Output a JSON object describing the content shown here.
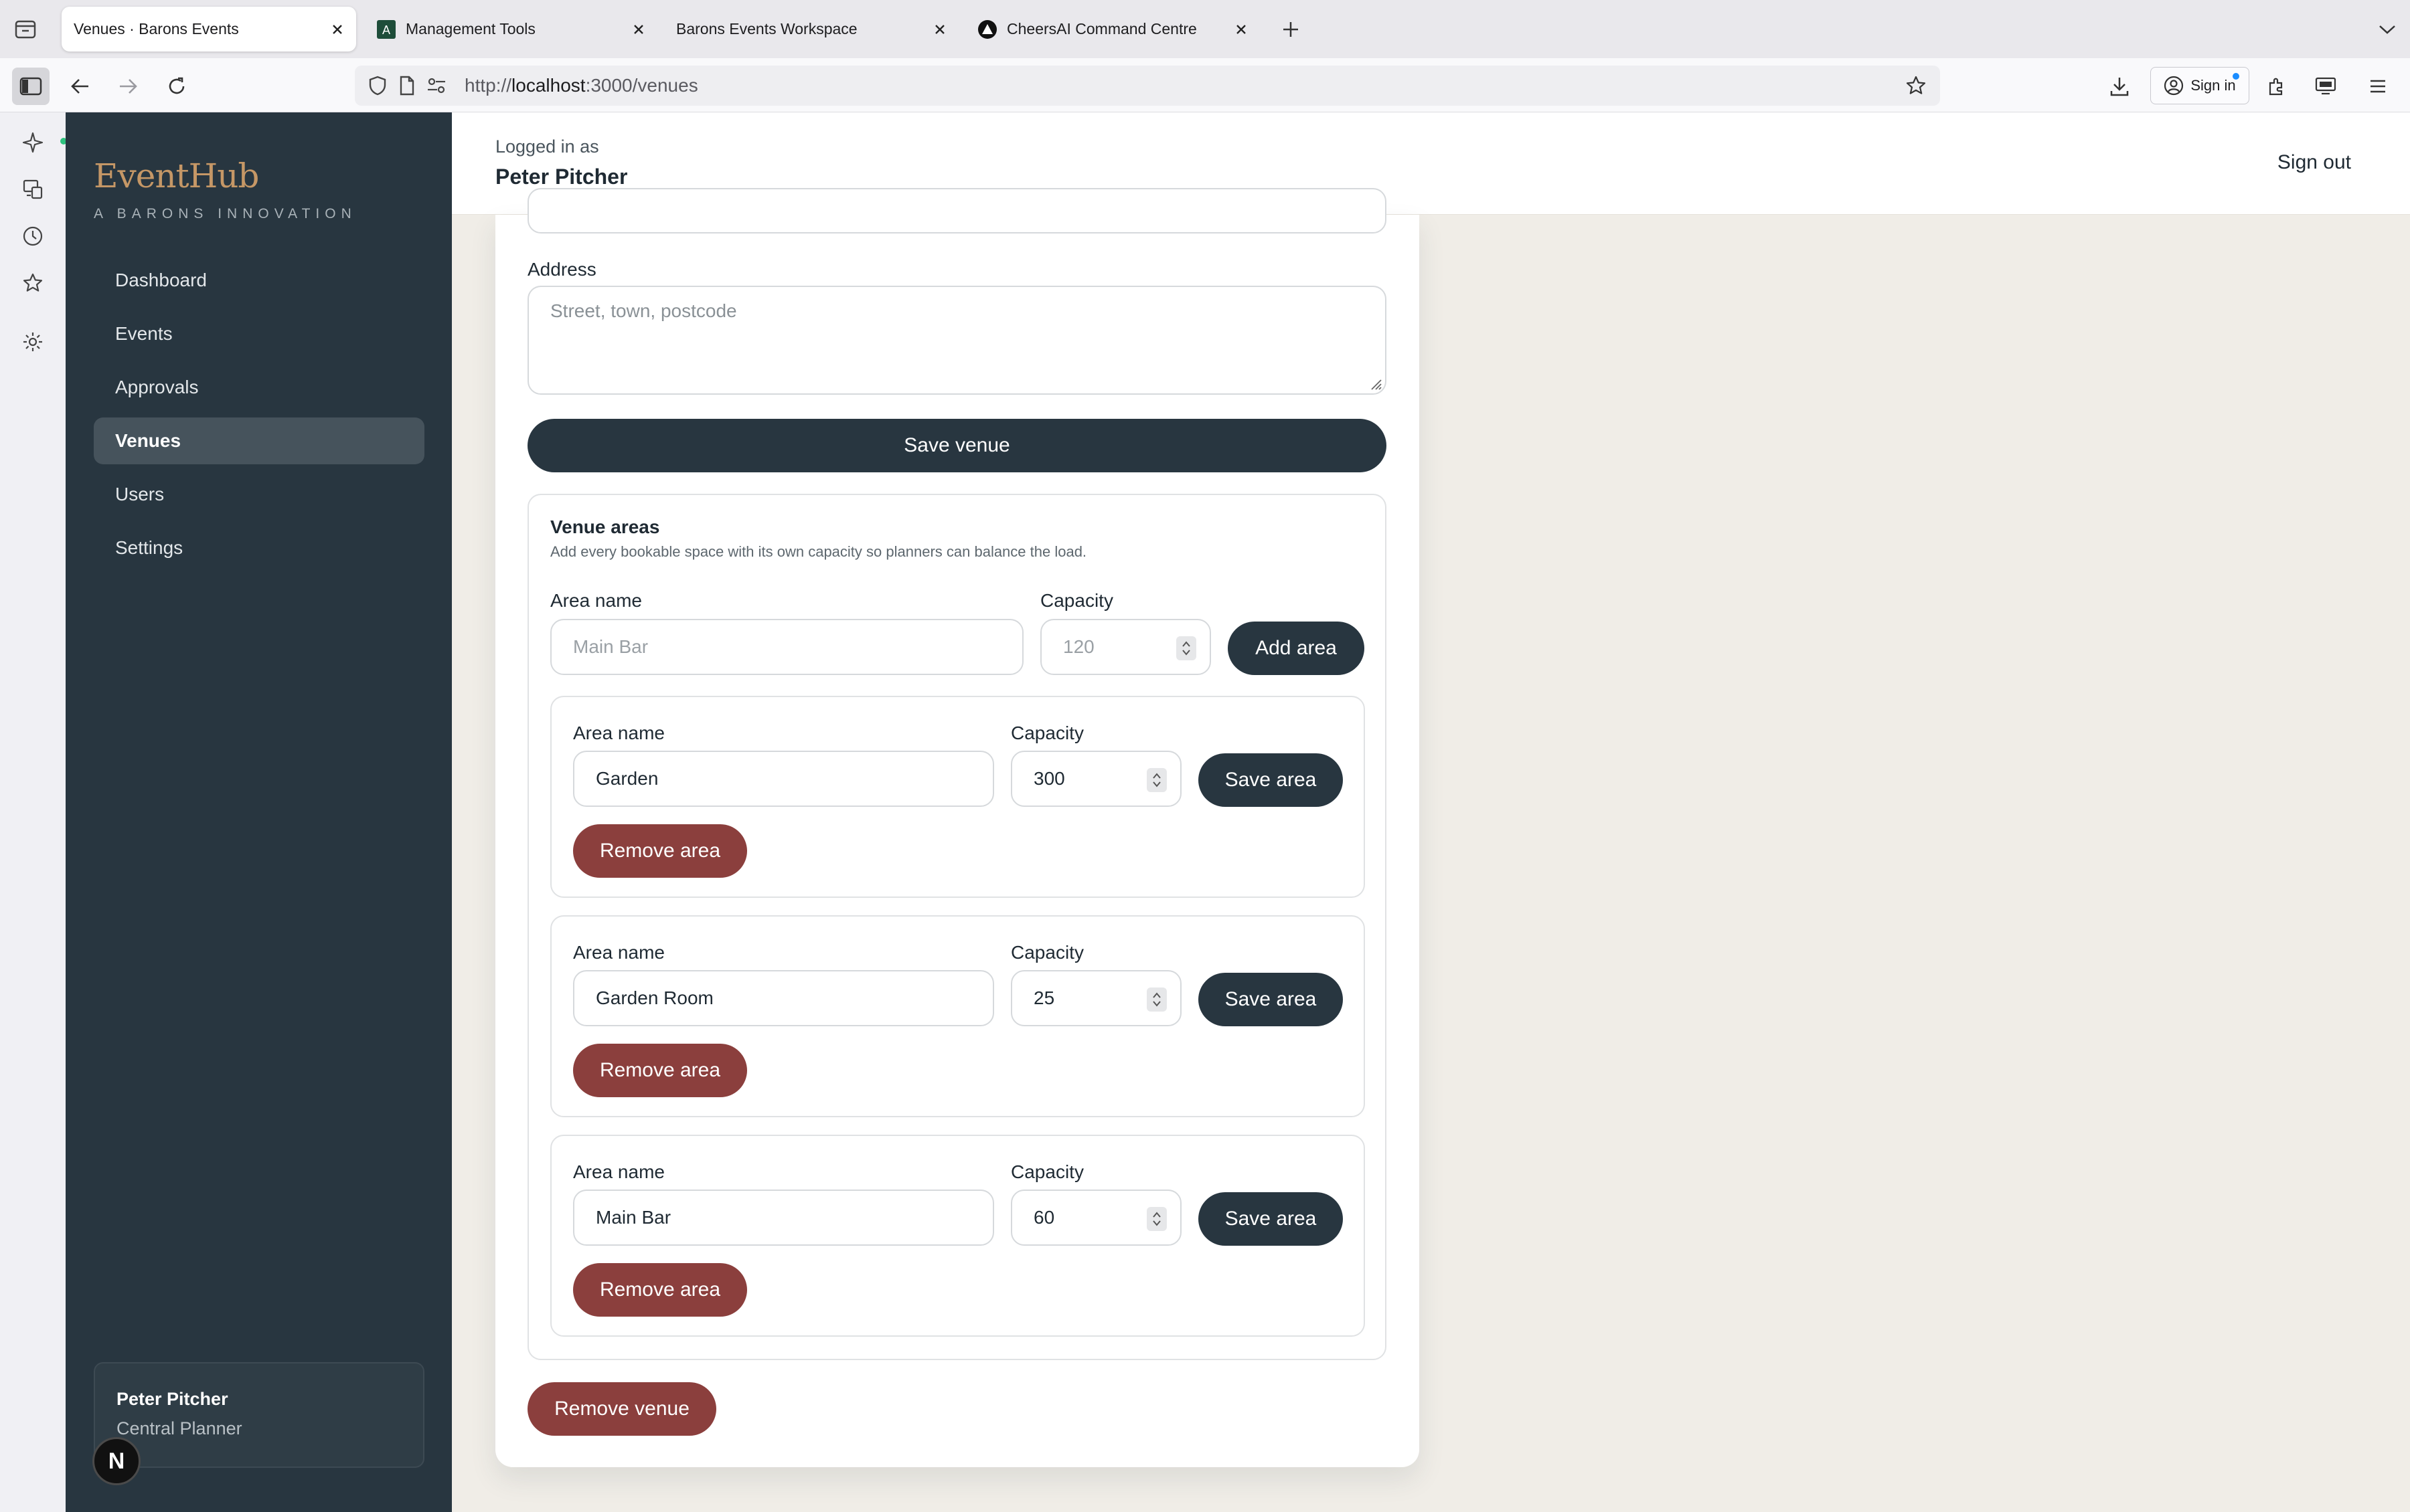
{
  "browser": {
    "tabs": [
      {
        "title": "Venues · Barons Events",
        "active": true
      },
      {
        "title": "Management Tools",
        "active": false
      },
      {
        "title": "Barons Events Workspace",
        "active": false
      },
      {
        "title": "CheersAI Command Centre",
        "active": false
      }
    ],
    "url_prefix": "http://",
    "url_host": "localhost",
    "url_rest": ":3000/venues",
    "signin_label": "Sign in"
  },
  "sidebar": {
    "brand": "EventHub",
    "brand_sub": "A BARONS INNOVATION",
    "items": [
      {
        "label": "Dashboard",
        "active": false
      },
      {
        "label": "Events",
        "active": false
      },
      {
        "label": "Approvals",
        "active": false
      },
      {
        "label": "Venues",
        "active": true
      },
      {
        "label": "Users",
        "active": false
      },
      {
        "label": "Settings",
        "active": false
      }
    ],
    "user": {
      "name": "Peter Pitcher",
      "role": "Central Planner"
    },
    "next_badge": "N"
  },
  "header": {
    "logged_label": "Logged in as",
    "user_name": "Peter Pitcher",
    "signout_label": "Sign out"
  },
  "venue_form": {
    "address_label": "Address",
    "address_placeholder": "Street, town, postcode",
    "save_label": "Save venue",
    "remove_label": "Remove venue"
  },
  "areas": {
    "title": "Venue areas",
    "description": "Add every bookable space with its own capacity so planners can balance the load.",
    "new_area": {
      "name_label": "Area name",
      "name_placeholder": "Main Bar",
      "capacity_label": "Capacity",
      "capacity_placeholder": "120",
      "add_label": "Add area"
    },
    "items": [
      {
        "name_label": "Area name",
        "name": "Garden",
        "capacity_label": "Capacity",
        "capacity": "300",
        "save_label": "Save area",
        "remove_label": "Remove area"
      },
      {
        "name_label": "Area name",
        "name": "Garden Room",
        "capacity_label": "Capacity",
        "capacity": "25",
        "save_label": "Save area",
        "remove_label": "Remove area"
      },
      {
        "name_label": "Area name",
        "name": "Main Bar",
        "capacity_label": "Capacity",
        "capacity": "60",
        "save_label": "Save area",
        "remove_label": "Remove area"
      }
    ]
  },
  "colors": {
    "sidebar_bg": "#283640",
    "brand_gold": "#c59766",
    "primary_button": "#283640",
    "danger_button": "#8b3f3d",
    "page_bg": "#f0ede7"
  }
}
